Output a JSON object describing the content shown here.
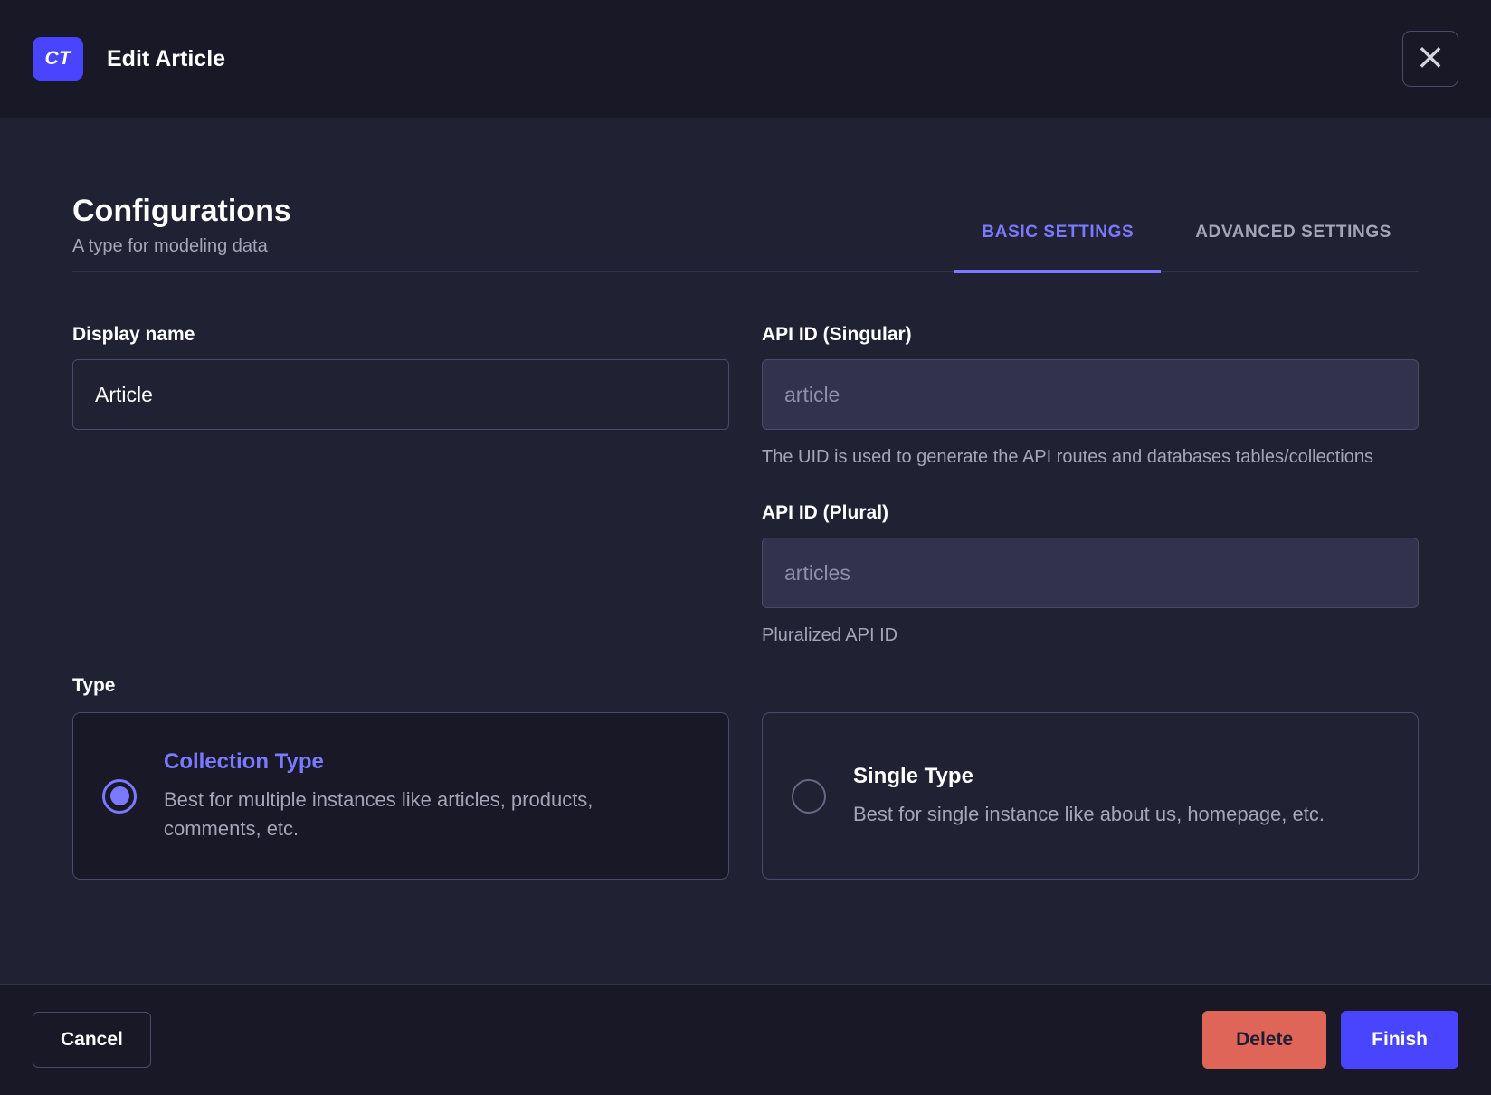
{
  "header": {
    "badge": "CT",
    "title": "Edit Article",
    "close_icon": "×"
  },
  "config": {
    "title": "Configurations",
    "subtitle": "A type for modeling data",
    "tabs": [
      {
        "label": "BASIC SETTINGS",
        "active": true
      },
      {
        "label": "ADVANCED SETTINGS",
        "active": false
      }
    ]
  },
  "form": {
    "display_name": {
      "label": "Display name",
      "value": "Article"
    },
    "api_id_singular": {
      "label": "API ID (Singular)",
      "placeholder": "article",
      "hint": "The UID is used to generate the API routes and databases tables/collections"
    },
    "api_id_plural": {
      "label": "API ID (Plural)",
      "placeholder": "articles",
      "hint": "Pluralized API ID"
    },
    "type": {
      "label": "Type",
      "options": [
        {
          "title": "Collection Type",
          "description": "Best for multiple instances like articles, products, comments, etc.",
          "selected": true
        },
        {
          "title": "Single Type",
          "description": "Best for single instance like about us, homepage, etc.",
          "selected": false
        }
      ]
    }
  },
  "footer": {
    "cancel_label": "Cancel",
    "delete_label": "Delete",
    "finish_label": "Finish"
  },
  "colors": {
    "accent": "#4945ff",
    "accent_light": "#7b79ff",
    "danger": "#de6557",
    "header_bg": "#181826",
    "body_bg": "#212134"
  }
}
